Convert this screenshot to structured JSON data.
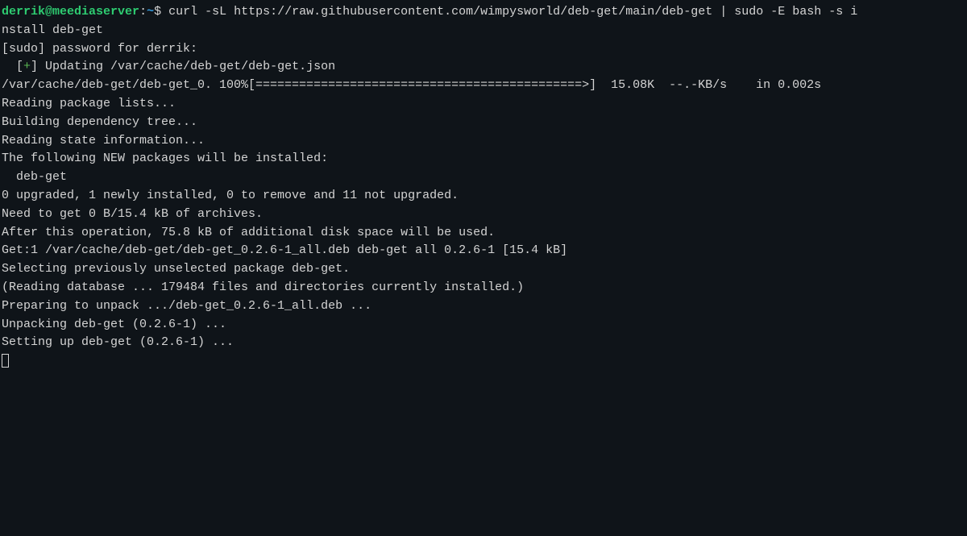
{
  "prompt": {
    "user": "derrik",
    "at": "@",
    "host": "meediaserver",
    "colon": ":",
    "path": "~",
    "dollar": "$ "
  },
  "command_line1": "curl -sL https://raw.githubusercontent.com/wimpysworld/deb-get/main/deb-get | sudo -E bash -s i",
  "command_line2": "nstall deb-get",
  "lines": {
    "l3": "[sudo] password for derrik:",
    "l4_prefix": "  [",
    "l4_plus": "+",
    "l4_suffix": "] Updating /var/cache/deb-get/deb-get.json",
    "l5": "/var/cache/deb-get/deb-get_0. 100%[=============================================>]  15.08K  --.-KB/s    in 0.002s",
    "l6": "Reading package lists...",
    "l7": "Building dependency tree...",
    "l8": "Reading state information...",
    "l9": "The following NEW packages will be installed:",
    "l10": "  deb-get",
    "l11": "0 upgraded, 1 newly installed, 0 to remove and 11 not upgraded.",
    "l12": "Need to get 0 B/15.4 kB of archives.",
    "l13": "After this operation, 75.8 kB of additional disk space will be used.",
    "l14": "Get:1 /var/cache/deb-get/deb-get_0.2.6-1_all.deb deb-get all 0.2.6-1 [15.4 kB]",
    "l15": "Selecting previously unselected package deb-get.",
    "l16": "(Reading database ... 179484 files and directories currently installed.)",
    "l17": "Preparing to unpack .../deb-get_0.2.6-1_all.deb ...",
    "l18": "Unpacking deb-get (0.2.6-1) ...",
    "l19": "Setting up deb-get (0.2.6-1) ..."
  }
}
